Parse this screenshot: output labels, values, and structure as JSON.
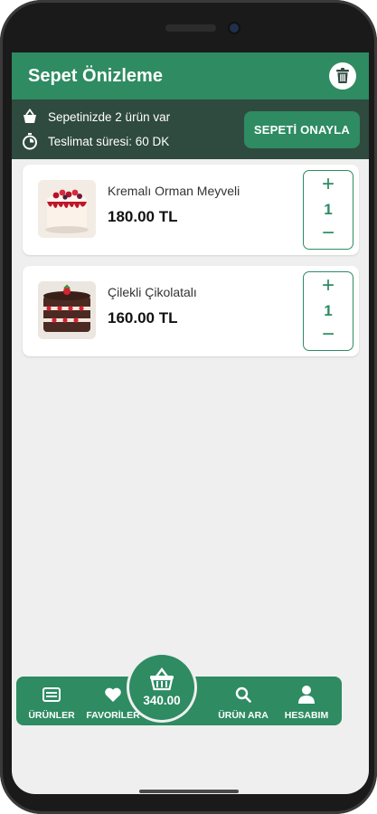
{
  "appbar": {
    "title": "Sepet Önizleme",
    "trash_icon": "trash-icon"
  },
  "summary": {
    "items_text": "Sepetinizde 2 ürün var",
    "delivery_text": "Teslimat süresi: 60 DK",
    "confirm_label": "SEPETİ ONAYLA"
  },
  "cart": {
    "items": [
      {
        "name": "Kremalı Orman Meyveli",
        "price": "180.00 TL",
        "quantity": "1",
        "plus": "+",
        "minus": "−"
      },
      {
        "name": "Çilekli Çikolatalı",
        "price": "160.00 TL",
        "quantity": "1",
        "plus": "+",
        "minus": "−"
      }
    ]
  },
  "nav": {
    "products_label": "ÜRÜNLER",
    "favorites_label": "FAVORİLER",
    "basket_total": "340.00",
    "search_label": "ÜRÜN ARA",
    "account_label": "HESABIM"
  },
  "colors": {
    "primary": "#2e8b62",
    "infobar": "#2f4a3f",
    "background": "#efefef"
  }
}
